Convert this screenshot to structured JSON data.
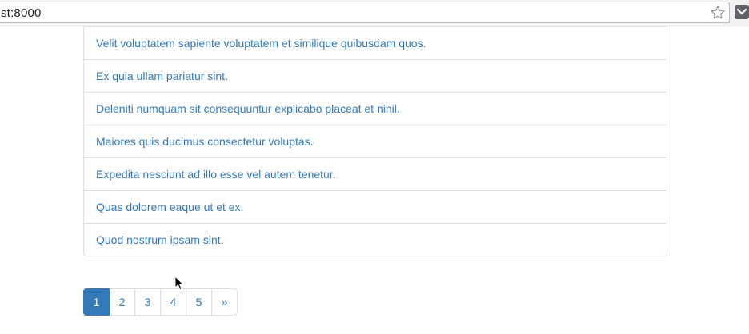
{
  "browser": {
    "url": "st:8000"
  },
  "list": {
    "items": [
      "Velit voluptatem sapiente voluptatem et similique quibusdam quos.",
      "Ex quia ullam pariatur sint.",
      "Deleniti numquam sit consequuntur explicabo placeat et nihil.",
      "Maiores quis ducimus consectetur voluptas.",
      "Expedita nesciunt ad illo esse vel autem tenetur.",
      "Quas dolorem eaque ut et ex.",
      "Quod nostrum ipsam sint."
    ]
  },
  "pagination": {
    "pages": [
      "1",
      "2",
      "3",
      "4",
      "5"
    ],
    "next": "»",
    "active_page": "1"
  },
  "colors": {
    "link": "#337ab7",
    "active_bg": "#337ab7",
    "border": "#dddddd"
  },
  "icons": {
    "bookmark": "star-icon",
    "extension": "pocket-icon",
    "pointer": "cursor-icon"
  }
}
